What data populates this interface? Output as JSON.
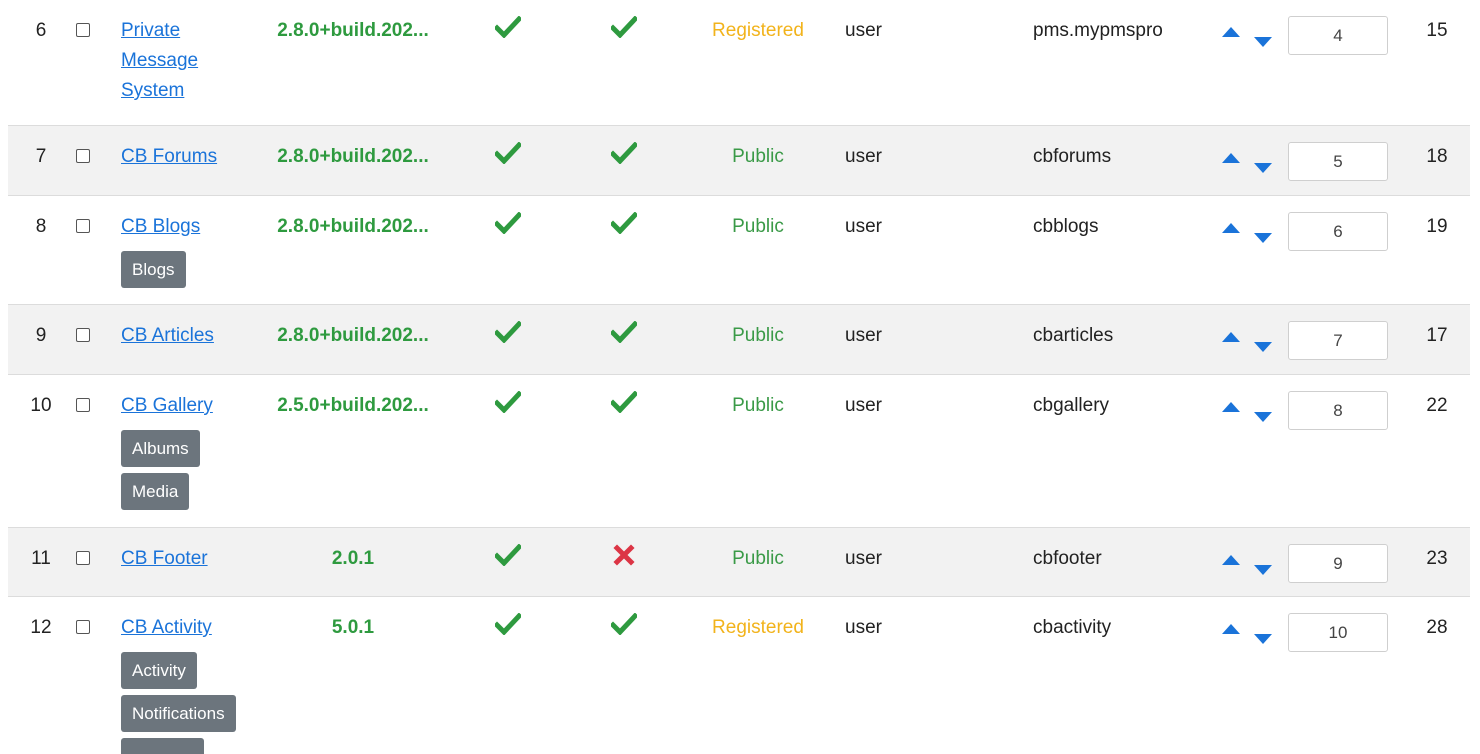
{
  "colors": {
    "link": "#1a73d9",
    "success": "#2e9a3f",
    "danger": "#dc3545",
    "registered": "#f2b31b",
    "public": "#3a9a47",
    "tag_bg": "#6c757d",
    "arrow": "#1a73d9"
  },
  "rows": [
    {
      "num": "6",
      "title": "Private Message System",
      "version": "2.8.0+build.202...",
      "published": "check",
      "compat": "check",
      "access": "Registered",
      "type": "user",
      "element": "pms.mypmspro",
      "ordering": "4",
      "id": "15",
      "tags": []
    },
    {
      "num": "7",
      "title": "CB Forums",
      "version": "2.8.0+build.202...",
      "published": "check",
      "compat": "check",
      "access": "Public",
      "type": "user",
      "element": "cbforums",
      "ordering": "5",
      "id": "18",
      "tags": []
    },
    {
      "num": "8",
      "title": "CB Blogs",
      "version": "2.8.0+build.202...",
      "published": "check",
      "compat": "check",
      "access": "Public",
      "type": "user",
      "element": "cbblogs",
      "ordering": "6",
      "id": "19",
      "tags": [
        "Blogs"
      ]
    },
    {
      "num": "9",
      "title": "CB Articles",
      "version": "2.8.0+build.202...",
      "published": "check",
      "compat": "check",
      "access": "Public",
      "type": "user",
      "element": "cbarticles",
      "ordering": "7",
      "id": "17",
      "tags": []
    },
    {
      "num": "10",
      "title": "CB Gallery",
      "version": "2.5.0+build.202...",
      "published": "check",
      "compat": "check",
      "access": "Public",
      "type": "user",
      "element": "cbgallery",
      "ordering": "8",
      "id": "22",
      "tags": [
        "Albums",
        "Media"
      ]
    },
    {
      "num": "11",
      "title": "CB Footer",
      "version": "2.0.1",
      "published": "check",
      "compat": "cross",
      "access": "Public",
      "type": "user",
      "element": "cbfooter",
      "ordering": "9",
      "id": "23",
      "tags": []
    },
    {
      "num": "12",
      "title": "CB Activity",
      "version": "5.0.1",
      "published": "check",
      "compat": "check",
      "access": "Registered",
      "type": "user",
      "element": "cbactivity",
      "ordering": "10",
      "id": "28",
      "tags": [
        "Activity",
        "Notifications"
      ]
    }
  ]
}
